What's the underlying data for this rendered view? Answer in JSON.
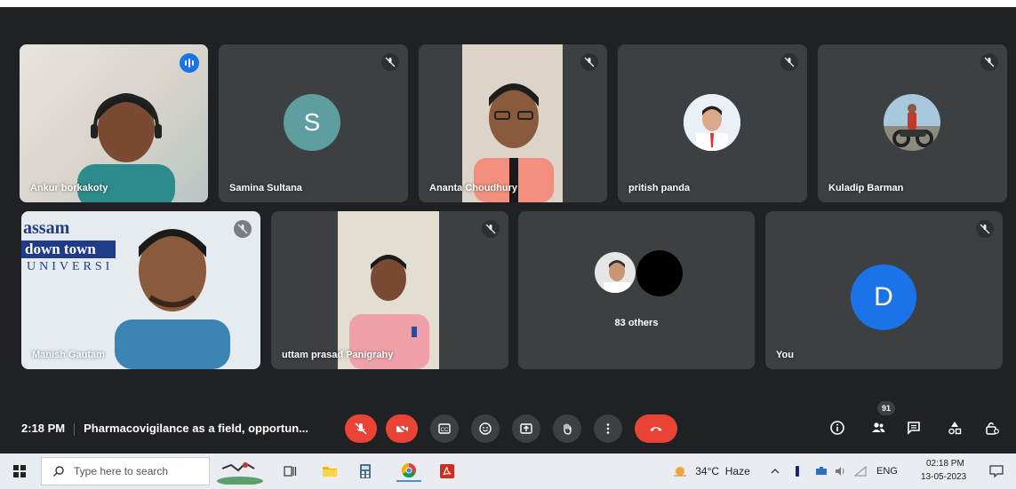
{
  "participants": {
    "ankur": {
      "name": "Ankur borkakoty"
    },
    "samina": {
      "name": "Samina Sultana",
      "initial": "S",
      "avatar_color": "#5f9ea0"
    },
    "ananta": {
      "name": "Ananta Choudhury"
    },
    "pritish": {
      "name": "pritish panda"
    },
    "kuladip": {
      "name": "Kuladip Barman"
    },
    "manish": {
      "name": "Manish Gautam"
    },
    "uttam": {
      "name": "uttam prasad Panigrahy"
    },
    "others": {
      "label": "83 others"
    },
    "you": {
      "name": "You",
      "initial": "D",
      "avatar_color": "#1a73e8"
    }
  },
  "banner": {
    "line1": "assam",
    "line2": "down town",
    "line3": "UNIVERSI"
  },
  "callbar": {
    "time": "2:18 PM",
    "meeting_title": "Pharmacovigilance as a field, opportun...",
    "people_count": "91",
    "icons": [
      "mic-off-icon",
      "camera-off-icon",
      "captions-icon",
      "emoji-icon",
      "present-icon",
      "raise-hand-icon",
      "more-icon",
      "leave-call-icon",
      "info-icon",
      "people-icon",
      "chat-icon",
      "activities-icon",
      "host-controls-icon"
    ]
  },
  "taskbar": {
    "search_placeholder": "Type here to search",
    "weather": "34°C  Haze",
    "language": "ENG",
    "clock_time": "02:18 PM",
    "clock_date": "13-05-2023"
  },
  "colors": {
    "accent": "#8ab4f8",
    "danger": "#ea4335",
    "tile": "#3c4043",
    "background": "#202124"
  }
}
